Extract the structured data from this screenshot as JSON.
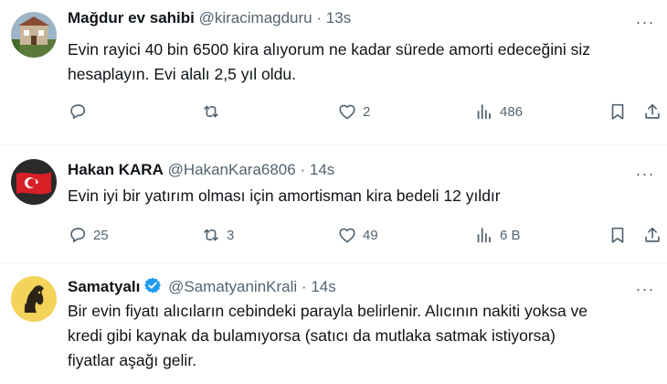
{
  "tweets": [
    {
      "name": "Mağdur ev sahibi",
      "handle": "@kiracimagduru",
      "separator": "·",
      "time": "13s",
      "more": "···",
      "text_lines": [
        "Evin rayici 40 bin 6500 kira alıyorum ne kadar sürede amorti edeceğini siz",
        "hesaplayın. Evi alalı 2,5 yıl oldu."
      ],
      "replies": "",
      "retweets": "",
      "likes": "2",
      "views": "486"
    },
    {
      "name": "Hakan KARA",
      "handle": "@HakanKara6806",
      "separator": "·",
      "time": "14s",
      "more": "···",
      "text_lines": [
        "Evin iyi bir yatırım olması için amortisman kira bedeli 12 yıldır"
      ],
      "replies": "25",
      "retweets": "3",
      "likes": "49",
      "views": "6 B"
    },
    {
      "name": "Samatyalı",
      "handle": "@SamatyaninKrali",
      "separator": "·",
      "time": "14s",
      "more": "···",
      "verified": true,
      "text_lines": [
        "Bir evin fiyatı alıcıların cebindeki parayla belirlenir. Alıcının nakiti yoksa ve",
        "kredi gibi kaynak da bulamıyorsa (satıcı da mutlaka satmak istiyorsa)",
        "fiyatlar aşağı gelir."
      ]
    }
  ],
  "icons": {
    "reply": "reply-icon",
    "retweet": "retweet-icon",
    "like": "heart-icon",
    "views": "views-icon",
    "bookmark": "bookmark-icon",
    "share": "share-icon"
  },
  "colors": {
    "text": "#0f1419",
    "secondary": "#536471",
    "verified": "#1d9bf0",
    "divider": "#eff3f4"
  }
}
